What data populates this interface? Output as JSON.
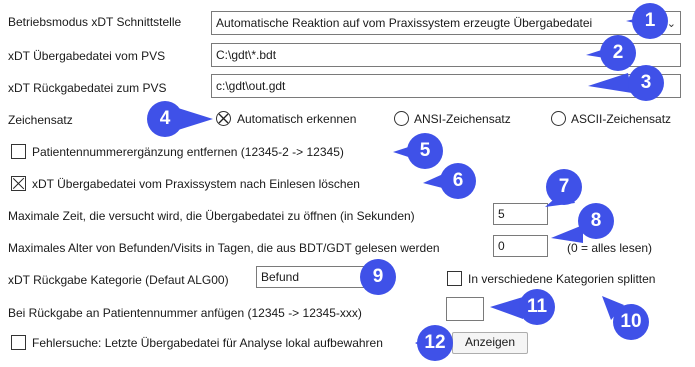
{
  "rows": {
    "mode_label": "Betriebsmodus xDT Schnittstelle",
    "mode_value": "Automatische Reaktion auf vom Praxissystem erzeugte Übergabedatei",
    "in_file_label": "xDT Übergabedatei vom PVS",
    "in_file_value": "C:\\gdt\\*.bdt",
    "out_file_label": "xDT Rückgabedatei zum PVS",
    "out_file_value": "c:\\gdt\\out.gdt",
    "charset_label": "Zeichensatz",
    "charset_options": [
      "Automatisch erkennen",
      "ANSI-Zeichensatz",
      "ASCII-Zeichensatz"
    ],
    "patnum_strip_label": "Patientennummerergänzung entfernen (12345-2 -> 12345)",
    "delete_after_label": "xDT Übergabedatei vom Praxissystem nach Einlesen löschen",
    "max_time_label": "Maximale Zeit, die versucht wird, die Übergabedatei zu öffnen (in Sekunden)",
    "max_time_value": "5",
    "max_age_label": "Maximales Alter von Befunden/Visits in Tagen, die aus BDT/GDT gelesen werden",
    "max_age_value": "0",
    "max_age_hint": "(0 = alles lesen)",
    "category_label": "xDT Rückgabe Kategorie (Defaut ALG00)",
    "category_value": "Befund",
    "split_label": "In verschiedene Kategorien splitten",
    "append_label": "Bei Rückgabe an Patientennummer anfügen (12345 -> 12345-xxx)",
    "append_value": "",
    "debug_label": "Fehlersuche: Letzte Übergabedatei für Analyse lokal aufbewahren",
    "show_button": "Anzeigen"
  },
  "badges": [
    "1",
    "2",
    "3",
    "4",
    "5",
    "6",
    "7",
    "8",
    "9",
    "10",
    "11",
    "12"
  ],
  "colors": {
    "badge": "#3f51e8",
    "border": "#7a7a7a"
  }
}
